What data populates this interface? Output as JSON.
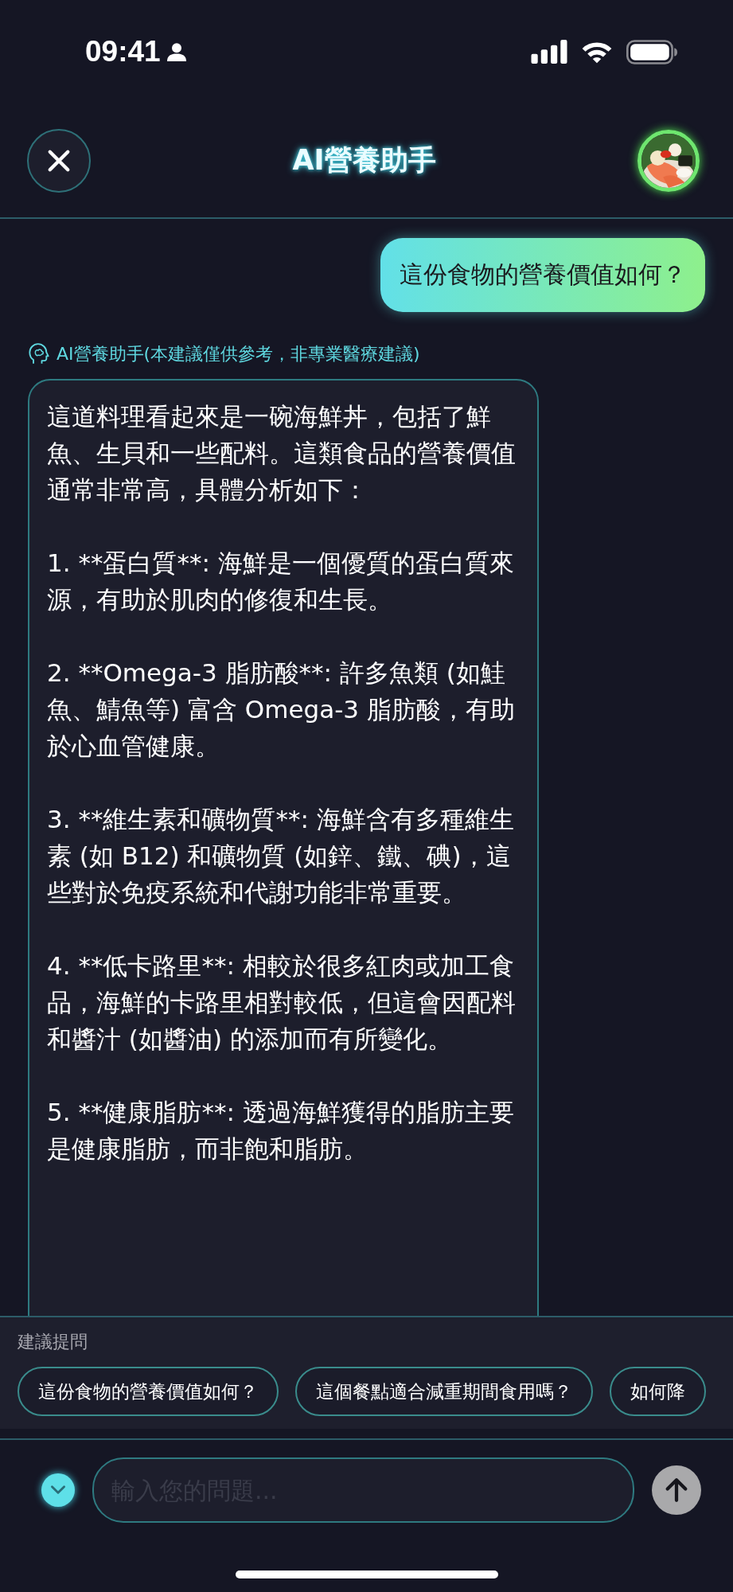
{
  "status_bar": {
    "time": "09:41"
  },
  "header": {
    "title": "AI營養助手"
  },
  "messages": [
    {
      "kind": "user",
      "text": "這份食物的營養價值如何？"
    },
    {
      "kind": "assistant",
      "label": "AI營養助手(本建議僅供參考，非專業醫療建議)",
      "paragraphs": [
        "這道料理看起來是一碗海鮮丼，包括了鮮魚、生貝和一些配料。這類食品的營養價值通常非常高，具體分析如下：",
        "1. **蛋白質**: 海鮮是一個優質的蛋白質來源，有助於肌肉的修復和生長。",
        "2. **Omega-3 脂肪酸**: 許多魚類 (如鮭魚、鯖魚等) 富含 Omega-3 脂肪酸，有助於心血管健康。",
        "3. **維生素和礦物質**: 海鮮含有多種維生素 (如 B12) 和礦物質 (如鋅、鐵、碘)，這些對於免疫系統和代謝功能非常重要。",
        "4. **低卡路里**: 相較於很多紅肉或加工食品，海鮮的卡路里相對較低，但這會因配料和醬汁 (如醬油) 的添加而有所變化。",
        "5. **健康脂肪**: 透過海鮮獲得的脂肪主要是健康脂肪，而非飽和脂肪。"
      ]
    }
  ],
  "suggestions": {
    "title": "建議提問",
    "chips": [
      "這份食物的營養價值如何？",
      "這個餐點適合減重期間食用嗎？",
      "如何降"
    ]
  },
  "input": {
    "placeholder": "輸入您的問題..."
  },
  "send_button": {
    "disabled": true
  }
}
